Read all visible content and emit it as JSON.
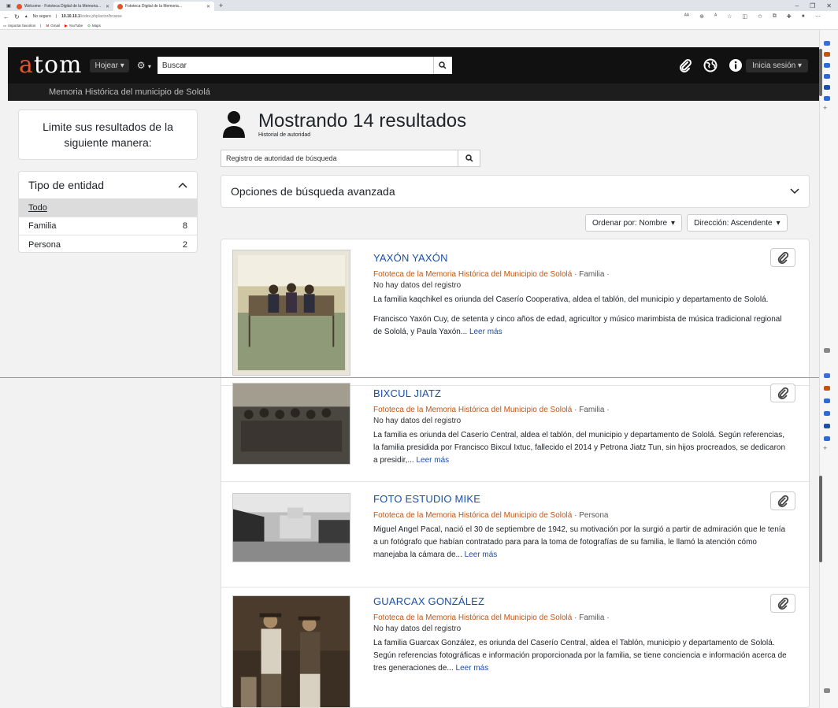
{
  "browser": {
    "tabs": [
      {
        "label": "Welcome - Fototeca Digital de la Memoria...",
        "active": false
      },
      {
        "label": "Fototeca Digital de la Memoria...",
        "active": true
      }
    ],
    "new_tab": "+",
    "address": {
      "security": "No seguro",
      "host": "10.10.10.1",
      "path": "/index.php/actor/browse"
    },
    "bookmarks": [
      "Importar favoritos",
      "Gmail",
      "YouTube",
      "Maps"
    ]
  },
  "header": {
    "logo_a": "a",
    "logo_rest": "tom",
    "browse_label": "Hojear",
    "search_placeholder": "Buscar",
    "login_label": "Inicia sesión",
    "site_name": "Memoria Histórica del municipio de Sololá"
  },
  "sidebar": {
    "intro": "Limite sus resultados de la siguiente manera:",
    "facet_title": "Tipo de entidad",
    "items": [
      {
        "label": "Todo",
        "count": ""
      },
      {
        "label": "Familia",
        "count": "8"
      },
      {
        "label": "Persona",
        "count": "2"
      }
    ]
  },
  "main": {
    "title": "Mostrando 14 resultados",
    "subtitle": "Historial de autoridad",
    "auth_search_placeholder": "Registro de autoridad de búsqueda",
    "advanced_label": "Opciones de búsqueda avanzada",
    "sort_label": "Ordenar por: Nombre",
    "direction_label": "Dirección: Ascendente"
  },
  "results": [
    {
      "title": "YAXÓN YAXÓN",
      "repository": "Fototeca de la Memoria Histórica del Municipio de Sololá",
      "type": "· Familia ·",
      "nodata": "No hay datos del registro",
      "desc1": "La familia kaqchikel es oriunda del Caserío Cooperativa, aldea el tablón, del municipio y departamento de Sololá.",
      "desc2": "Francisco Yaxón Cuy, de setenta y cinco años de edad, agricultor y músico marimbista de música tradicional regional de Sololá, y Paula Yaxón...",
      "read_more": "Leer más"
    },
    {
      "title": "BIXCUL JIATZ",
      "repository": "Fototeca de la Memoria Histórica del Municipio de Sololá",
      "type": "· Familia ·",
      "nodata": "No hay datos del registro",
      "desc1": "La familia es oriunda del Caserío Central, aldea el tablón, del municipio y departamento de Sololá. Según referencias, la familia presidida por Francisco Bixcul Ixtuc, fallecido el 2014 y Petrona Jiatz Tun, sin hijos procreados, se dedicaron a presidir,...",
      "read_more": "Leer más"
    },
    {
      "title": "FOTO ESTUDIO MIKE",
      "repository": "Fototeca de la Memoria Histórica del Municipio de Sololá",
      "type": "· Persona",
      "desc1": "Miguel Angel Pacal, nació el 30 de septiembre de 1942, su motivación por la surgió a partir de admiración que le tenía a un fotógrafo que habían contratado para para la toma de fotografías de su familia, le llamó la atención cómo manejaba la cámara de...",
      "read_more": "Leer más"
    },
    {
      "title": "GUARCAX GONZÁLEZ",
      "repository": "Fototeca de la Memoria Histórica del Municipio de Sololá",
      "type": "· Familia ·",
      "nodata": "No hay datos del registro",
      "desc1": "La familia Guarcax González, es oriunda del Caserío Central, aldea el Tablón, municipio y departamento de Sololá. Según referencias fotográficas e información proporcionada por la familia, se tiene conciencia e información acerca de tres generaciones de...",
      "read_more": "Leer más"
    }
  ],
  "colors": {
    "accent_logo": "#e0552b",
    "link": "#1b4fa8",
    "repository": "#c1550f",
    "header_bg": "#111111"
  },
  "icons": [
    "paperclip-icon",
    "globe-icon",
    "info-icon",
    "search-icon",
    "gear-icon",
    "person-icon",
    "chevron-down-icon",
    "chevron-up-icon"
  ]
}
